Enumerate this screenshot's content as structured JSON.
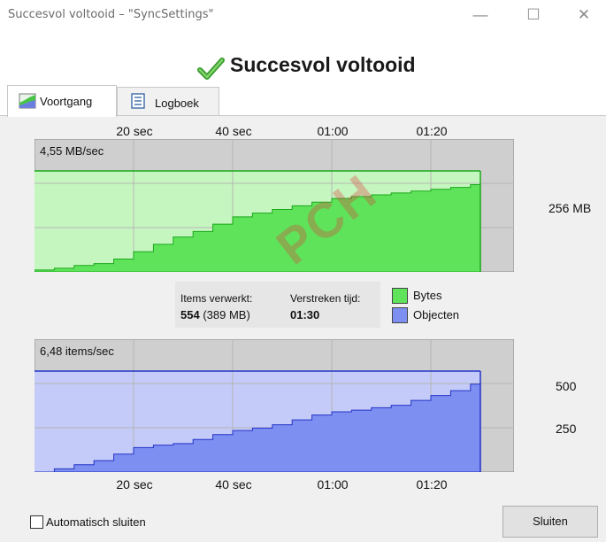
{
  "window": {
    "title": "Succesvol voltooid – \"SyncSettings\"",
    "heading": "Succesvol voltooid",
    "minimize_glyph": "—",
    "maximize_glyph": "☐",
    "close_glyph": "✕"
  },
  "tabs": [
    {
      "label": "Voortgang",
      "icon": "progress-chart-icon",
      "active": true
    },
    {
      "label": "Logboek",
      "icon": "log-icon",
      "active": false
    }
  ],
  "time_ticks": [
    "20 sec",
    "40 sec",
    "01:00",
    "01:20"
  ],
  "speed_chart": {
    "rate_label": "4,55 MB/sec",
    "right_label": "256 MB",
    "fill_color": "#c6f6c0",
    "series_color": "#5fe35a",
    "line_color": "#1aa81a"
  },
  "items_chart": {
    "rate_label": "6,48 items/sec",
    "right_labels": [
      "500",
      "250"
    ],
    "fill_color": "#c4cbf8",
    "series_color": "#7d8ff0",
    "line_color": "#2433c8"
  },
  "stats": {
    "items_caption": "Items verwerkt:",
    "items_count": "554",
    "items_size": "(389 MB)",
    "time_caption": "Verstreken tijd:",
    "time_value": "01:30"
  },
  "legend": [
    {
      "label": "Bytes",
      "color": "#5fe35a"
    },
    {
      "label": "Objecten",
      "color": "#7d8ff0"
    }
  ],
  "watermark": "PCH",
  "footer": {
    "auto_close_label": "Automatisch sluiten",
    "auto_close_checked": false,
    "close_button_label": "Sluiten"
  },
  "chart_data": [
    {
      "type": "area",
      "x": [
        0,
        4,
        8,
        12,
        16,
        20,
        24,
        28,
        32,
        36,
        40,
        44,
        48,
        52,
        56,
        60,
        64,
        68,
        72,
        76,
        80,
        84,
        88,
        90
      ],
      "series": [
        {
          "name": "Bytes",
          "values": [
            2,
            4,
            7,
            9,
            14,
            22,
            30,
            38,
            44,
            52,
            60,
            64,
            68,
            72,
            76,
            80,
            82,
            84,
            86,
            88,
            90,
            92,
            95,
            98
          ]
        }
      ],
      "title": "",
      "xlabel": "",
      "ylabel": "",
      "xlim": [
        0,
        90
      ],
      "ylim": [
        0,
        110
      ],
      "grid": true
    },
    {
      "type": "area",
      "x": [
        0,
        4,
        8,
        12,
        16,
        20,
        24,
        28,
        32,
        36,
        40,
        44,
        48,
        52,
        56,
        60,
        64,
        68,
        72,
        76,
        80,
        84,
        88,
        90
      ],
      "series": [
        {
          "name": "Objecten",
          "values": [
            0,
            20,
            45,
            70,
            110,
            150,
            165,
            175,
            200,
            230,
            255,
            270,
            290,
            320,
            350,
            370,
            380,
            395,
            410,
            440,
            470,
            500,
            540,
            554
          ]
        }
      ],
      "title": "",
      "xlabel": "",
      "ylabel": "",
      "xlim": [
        0,
        90
      ],
      "ylim": [
        0,
        620
      ],
      "grid": true
    }
  ]
}
